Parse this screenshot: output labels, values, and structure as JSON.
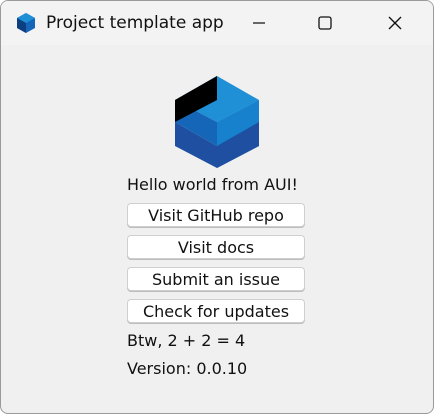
{
  "window": {
    "title": "Project template app"
  },
  "titlebar_controls": {
    "minimize_icon": "minimize-icon",
    "maximize_icon": "maximize-icon",
    "close_icon": "close-icon"
  },
  "main": {
    "logo_icon": "aui-cube-logo",
    "greeting": "Hello world from AUI!",
    "buttons": [
      {
        "label": "Visit GitHub repo"
      },
      {
        "label": "Visit docs"
      },
      {
        "label": "Submit an issue"
      },
      {
        "label": "Check for updates"
      }
    ],
    "math_line": "Btw, 2 + 2 = 4",
    "version_line": "Version: 0.0.10"
  },
  "colors": {
    "window_bg": "#f0f0f0",
    "titlebar_bg": "#f3f3f3",
    "logo_light_blue": "#1f8fd6",
    "logo_mid_blue": "#1565b8",
    "logo_dark_blue": "#1e4fa0",
    "logo_black": "#000000"
  }
}
